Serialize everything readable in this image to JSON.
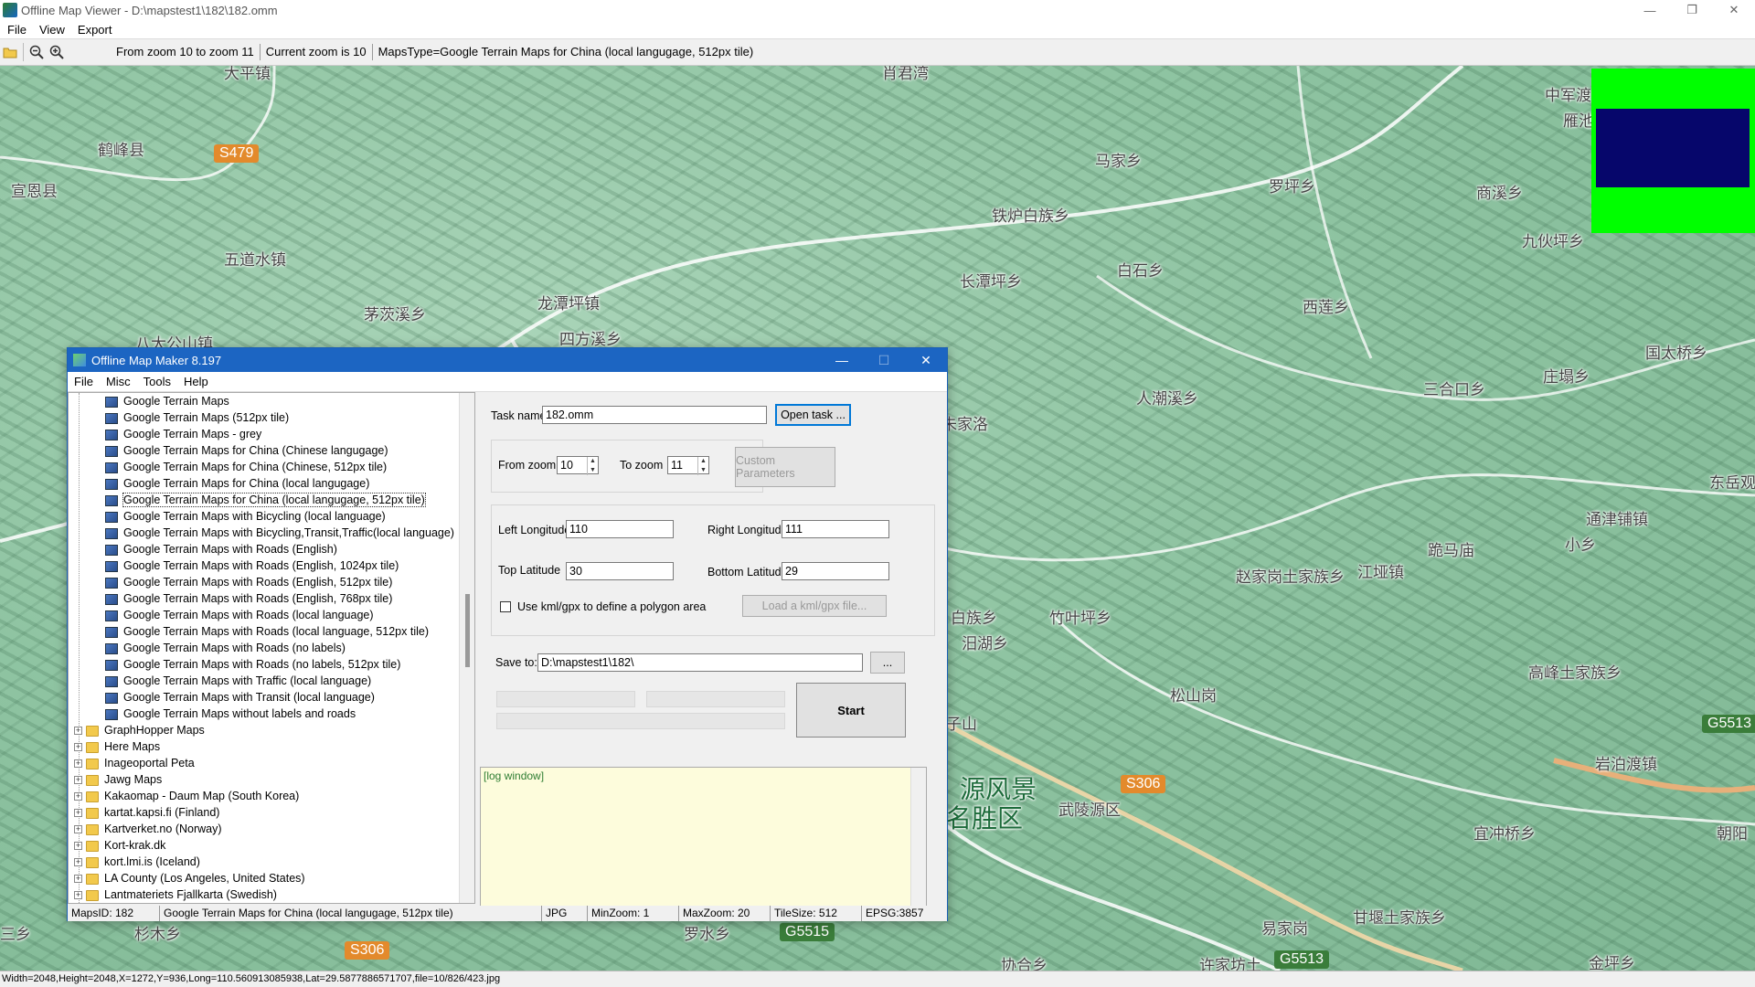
{
  "window": {
    "title": "Offline Map Viewer - D:\\mapstest1\\182\\182.omm",
    "controls": {
      "minimize": "—",
      "restore": "❐",
      "close": "✕"
    }
  },
  "menubar": {
    "items": [
      "File",
      "View",
      "Export"
    ]
  },
  "toolbar": {
    "zoom_range": "From zoom 10 to zoom 11",
    "current_zoom": "Current zoom is 10",
    "maps_type": "MapsType=Google Terrain Maps for China (local langugage, 512px tile)"
  },
  "map": {
    "places": [
      "大平镇",
      "鹤峰县",
      "宣恩县",
      "五道水镇",
      "茅茨溪乡",
      "龙潭坪镇",
      "四方溪乡",
      "八大公山镇",
      "肖君湾",
      "马家乡",
      "罗坪乡",
      "铁炉白族乡",
      "长潭坪乡",
      "白石乡",
      "西莲乡",
      "中军渡",
      "雁池",
      "商溪乡",
      "九伙坪乡",
      "国太桥乡",
      "庄塌乡",
      "三合口乡",
      "人潮溪乡",
      "朱家洛",
      "东岳观",
      "通津铺镇",
      "小乡",
      "跪马庙",
      "赵家岗土家族乡",
      "江垭镇",
      "白族乡",
      "竹叶坪乡",
      "汨湖乡",
      "松山岗",
      "高峰土家族乡",
      "岩泊渡镇",
      "宜冲桥乡",
      "朝阳",
      "易家岗",
      "甘堰土家族乡",
      "许家坊土",
      "金坪乡",
      "罗水乡",
      "杉木乡",
      "协合乡",
      "武陵源区",
      "源风景",
      "名胜区",
      "子山",
      "三乡"
    ],
    "shields": [
      "S479",
      "S306",
      "S306",
      "G5515",
      "G5513",
      "G5513"
    ],
    "status": "Width=2048,Height=2048,X=1272,Y=936,Long=110.560913085938,Lat=29.5877886571707,file=10/826/423.jpg"
  },
  "dialog": {
    "title": "Offline Map Maker 8.197",
    "menu": [
      "File",
      "Misc",
      "Tools",
      "Help"
    ],
    "tree_items": [
      "Google Terrain Maps",
      "Google Terrain Maps (512px tile)",
      "Google Terrain Maps - grey",
      "Google Terrain Maps for China (Chinese langugage)",
      "Google Terrain Maps for China (Chinese, 512px tile)",
      "Google Terrain Maps for China (local langugage)",
      "Google Terrain Maps for China (local langugage, 512px tile)",
      "Google Terrain Maps with Bicycling (local language)",
      "Google Terrain Maps with Bicycling,Transit,Traffic(local language)",
      "Google Terrain Maps with Roads (English)",
      "Google Terrain Maps with Roads (English, 1024px tile)",
      "Google Terrain Maps with Roads (English, 512px tile)",
      "Google Terrain Maps with Roads (English, 768px tile)",
      "Google Terrain Maps with Roads (local language)",
      "Google Terrain Maps with Roads (local language, 512px tile)",
      "Google Terrain Maps with Roads (no labels)",
      "Google Terrain Maps with Roads (no labels, 512px tile)",
      "Google Terrain Maps with Traffic (local language)",
      "Google Terrain Maps with Transit (local language)",
      "Google Terrain Maps without labels and roads"
    ],
    "tree_folders": [
      "GraphHopper Maps",
      "Here Maps",
      "Inageoportal Peta",
      "Jawg Maps",
      "Kakaomap - Daum Map (South Korea)",
      "kartat.kapsi.fi (Finland)",
      "Kartverket.no (Norway)",
      "Kort-krak.dk",
      "kort.lmi.is (Iceland)",
      "LA County (Los Angeles, United States)",
      "Lantmateriets Fjallkarta (Swedish)"
    ],
    "task_name_label": "Task name",
    "task_name_value": "182.omm",
    "open_task_label": "Open task ...",
    "from_zoom_label": "From zoom",
    "from_zoom_value": "10",
    "to_zoom_label": "To zoom",
    "to_zoom_value": "11",
    "custom_params_label": "Custom Parameters",
    "left_lon_label": "Left Longitude",
    "left_lon_value": "110",
    "right_lon_label": "Right Longitude",
    "right_lon_value": "111",
    "top_lat_label": "Top Latitude",
    "top_lat_value": "30",
    "bottom_lat_label": "Bottom Latitude",
    "bottom_lat_value": "29",
    "kml_checkbox_label": "Use kml/gpx to define a polygon area",
    "load_kml_label": "Load a kml/gpx file...",
    "save_to_label": "Save to:",
    "save_to_value": "D:\\mapstest1\\182\\",
    "browse_label": "...",
    "start_label": "Start",
    "log_title": "[log window]",
    "status": {
      "maps_id": "MapsID: 182",
      "maps_name": "Google Terrain Maps for China (local langugage, 512px tile)",
      "format": "JPG",
      "min_zoom": "MinZoom: 1",
      "max_zoom": "MaxZoom: 20",
      "tile_size": "TileSize: 512",
      "epsg": "EPSG:3857"
    }
  }
}
